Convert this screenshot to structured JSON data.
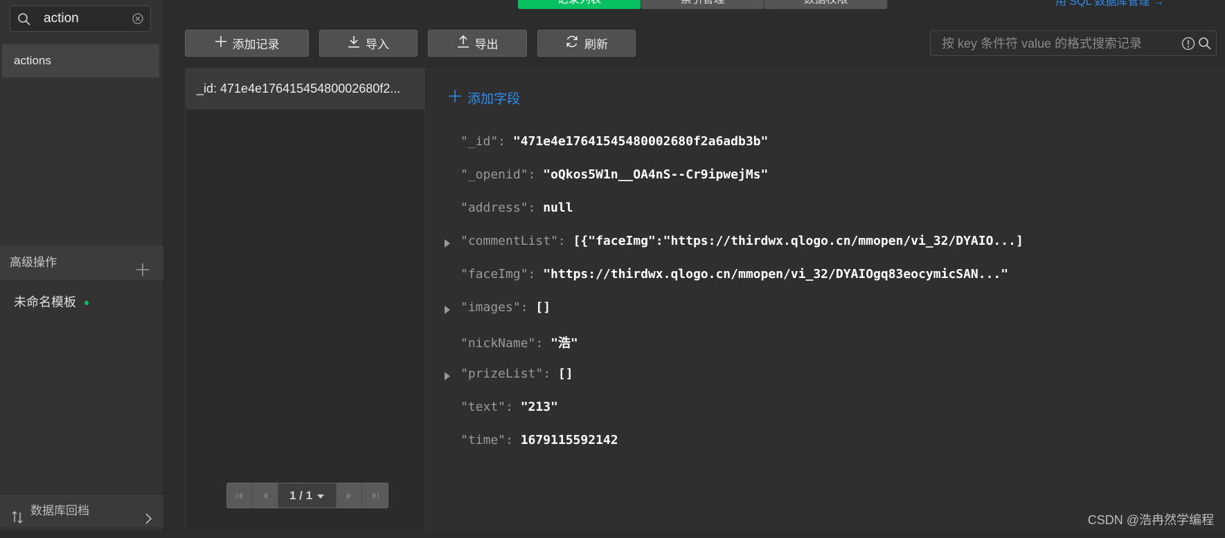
{
  "sidebar": {
    "search": {
      "value": "action",
      "placeholder": ""
    },
    "collections": [
      {
        "label": "actions"
      }
    ],
    "advanced_header": "高级操作",
    "templates": [
      {
        "label": "未命名模板"
      }
    ],
    "db_archive_label": "数据库回档"
  },
  "top_tabs": [
    {
      "label": "记录列表",
      "active": true
    },
    {
      "label": "索引管理",
      "active": false
    },
    {
      "label": "数据权限",
      "active": false
    }
  ],
  "top_right_link": "用 SQL 数据库管理 →",
  "toolbar": {
    "add_record": "添加记录",
    "import": "导入",
    "export": "导出",
    "refresh": "刷新",
    "search_placeholder": "按 key 条件符 value 的格式搜索记录"
  },
  "records": [
    {
      "label": "_id: 471e4e17641545480002680f2..."
    }
  ],
  "pager": {
    "text": "1 / 1"
  },
  "detail": {
    "add_field": "添加字段",
    "fields": [
      {
        "key": "\"_id\":",
        "value": "\"471e4e17641545480002680f2a6adb3b\"",
        "expandable": false
      },
      {
        "key": "\"_openid\":",
        "value": "\"oQkos5W1n__OA4nS--Cr9ipwejMs\"",
        "expandable": false
      },
      {
        "key": "\"address\":",
        "value": "null",
        "expandable": false
      },
      {
        "key": "\"commentList\":",
        "value": "[{\"faceImg\":\"https://thirdwx.qlogo.cn/mmopen/vi_32/DYAIO...]",
        "expandable": true
      },
      {
        "key": "\"faceImg\":",
        "value": "\"https://thirdwx.qlogo.cn/mmopen/vi_32/DYAIOgq83eocymicSAN...\"",
        "expandable": false
      },
      {
        "key": "\"images\":",
        "value": "[]",
        "expandable": true
      },
      {
        "key": "\"nickName\":",
        "value": "\"浩\"",
        "expandable": false
      },
      {
        "key": "\"prizeList\":",
        "value": "[]",
        "expandable": true
      },
      {
        "key": "\"text\":",
        "value": "\"213\"",
        "expandable": false
      },
      {
        "key": "\"time\":",
        "value": "1679115592142",
        "expandable": false
      }
    ]
  },
  "watermark": "CSDN @浩冉然学编程",
  "colors": {
    "accent_green": "#07c160",
    "link_blue": "#2d8cf0"
  }
}
